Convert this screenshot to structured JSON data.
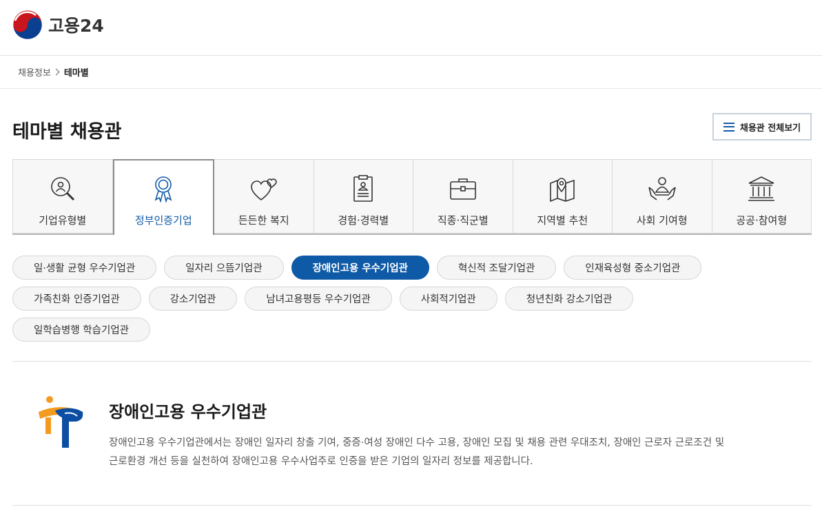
{
  "header": {
    "logo_text": "고용24"
  },
  "breadcrumb": {
    "parent": "채용정보",
    "current": "테마별"
  },
  "page": {
    "title": "테마별 채용관",
    "all_button_label": "채용관 전체보기"
  },
  "tabs": [
    {
      "label": "기업유형별",
      "icon": "magnify-person-icon"
    },
    {
      "label": "정부인증기업",
      "icon": "award-ribbon-icon"
    },
    {
      "label": "든든한 복지",
      "icon": "hearts-icon"
    },
    {
      "label": "경험·경력별",
      "icon": "clipboard-id-icon"
    },
    {
      "label": "직종·직군별",
      "icon": "briefcase-icon"
    },
    {
      "label": "지역별 추천",
      "icon": "map-pin-icon"
    },
    {
      "label": "사회 기여형",
      "icon": "hands-person-icon"
    },
    {
      "label": "공공·참여형",
      "icon": "bank-building-icon"
    }
  ],
  "chips": [
    {
      "label": "일·생활 균형 우수기업관"
    },
    {
      "label": "일자리 으뜸기업관"
    },
    {
      "label": "장애인고용 우수기업관"
    },
    {
      "label": "혁신적 조달기업관"
    },
    {
      "label": "인재육성형 중소기업관"
    },
    {
      "label": "가족친화 인증기업관"
    },
    {
      "label": "강소기업관"
    },
    {
      "label": "남녀고용평등 우수기업관"
    },
    {
      "label": "사회적기업관"
    },
    {
      "label": "청년친화 강소기업관"
    },
    {
      "label": "일학습병행 학습기업관"
    }
  ],
  "info": {
    "title": "장애인고용 우수기업관",
    "description_line1": "장애인고용 우수기업관에서는 장애인 일자리 창출 기여, 중증·여성 장애인 다수 고용, 장애인 모집 및 채용 관련 우대조치, 장애인 근로자 근로조건 및",
    "description_line2": "근로환경 개선 등을 실천하여 장애인고용 우수사업주로 인증을 받은 기업의 일자리 정보를 제공합니다."
  },
  "colors": {
    "accent": "#0f5aa6",
    "tab_bg": "#f7f7f7",
    "chip_bg": "#f5f5f5"
  }
}
